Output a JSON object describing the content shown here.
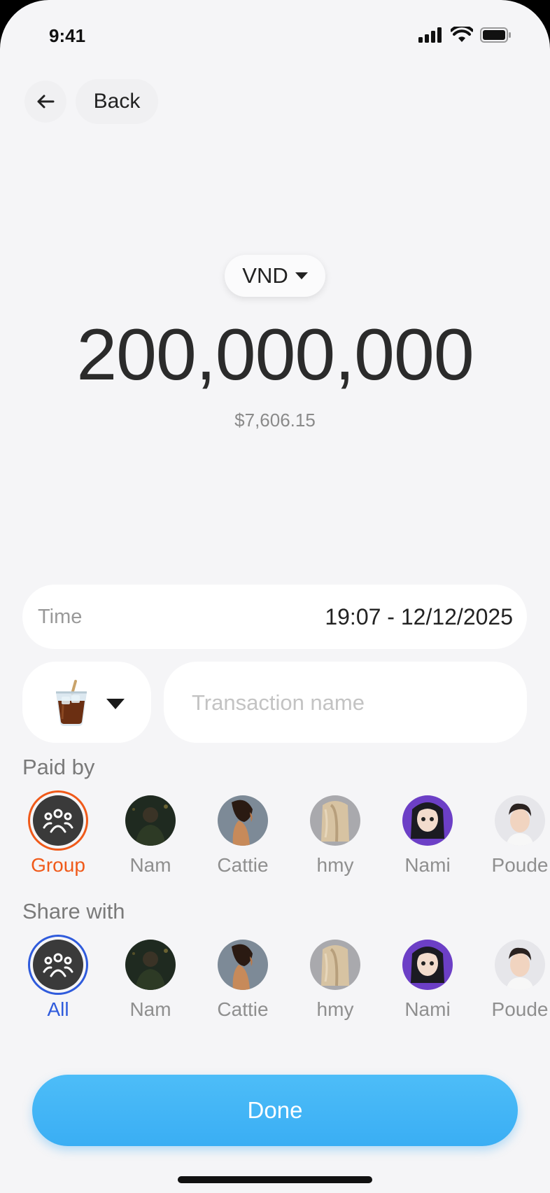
{
  "status_bar": {
    "time": "9:41"
  },
  "header": {
    "back_label": "Back"
  },
  "currency": {
    "code": "VND"
  },
  "amount": {
    "value": "200,000,000",
    "converted": "$7,606.15"
  },
  "time_field": {
    "label": "Time",
    "value": "19:07 - 12/12/2025"
  },
  "category": {
    "icon": "iced-coffee-icon"
  },
  "transaction_name": {
    "value": "",
    "placeholder": "Transaction name"
  },
  "paid_by": {
    "label": "Paid by",
    "items": [
      {
        "name": "Group",
        "selected": true,
        "accent": "#f05a1a"
      },
      {
        "name": "Nam"
      },
      {
        "name": "Cattie"
      },
      {
        "name": "hmy"
      },
      {
        "name": "Nami"
      },
      {
        "name": "Poude"
      }
    ]
  },
  "share_with": {
    "label": "Share with",
    "items": [
      {
        "name": "All",
        "selected": true,
        "accent": "#2f5bdc"
      },
      {
        "name": "Nam"
      },
      {
        "name": "Cattie"
      },
      {
        "name": "hmy"
      },
      {
        "name": "Nami"
      },
      {
        "name": "Poude"
      }
    ]
  },
  "done_button": {
    "label": "Done",
    "color": "#3fb4f6"
  }
}
